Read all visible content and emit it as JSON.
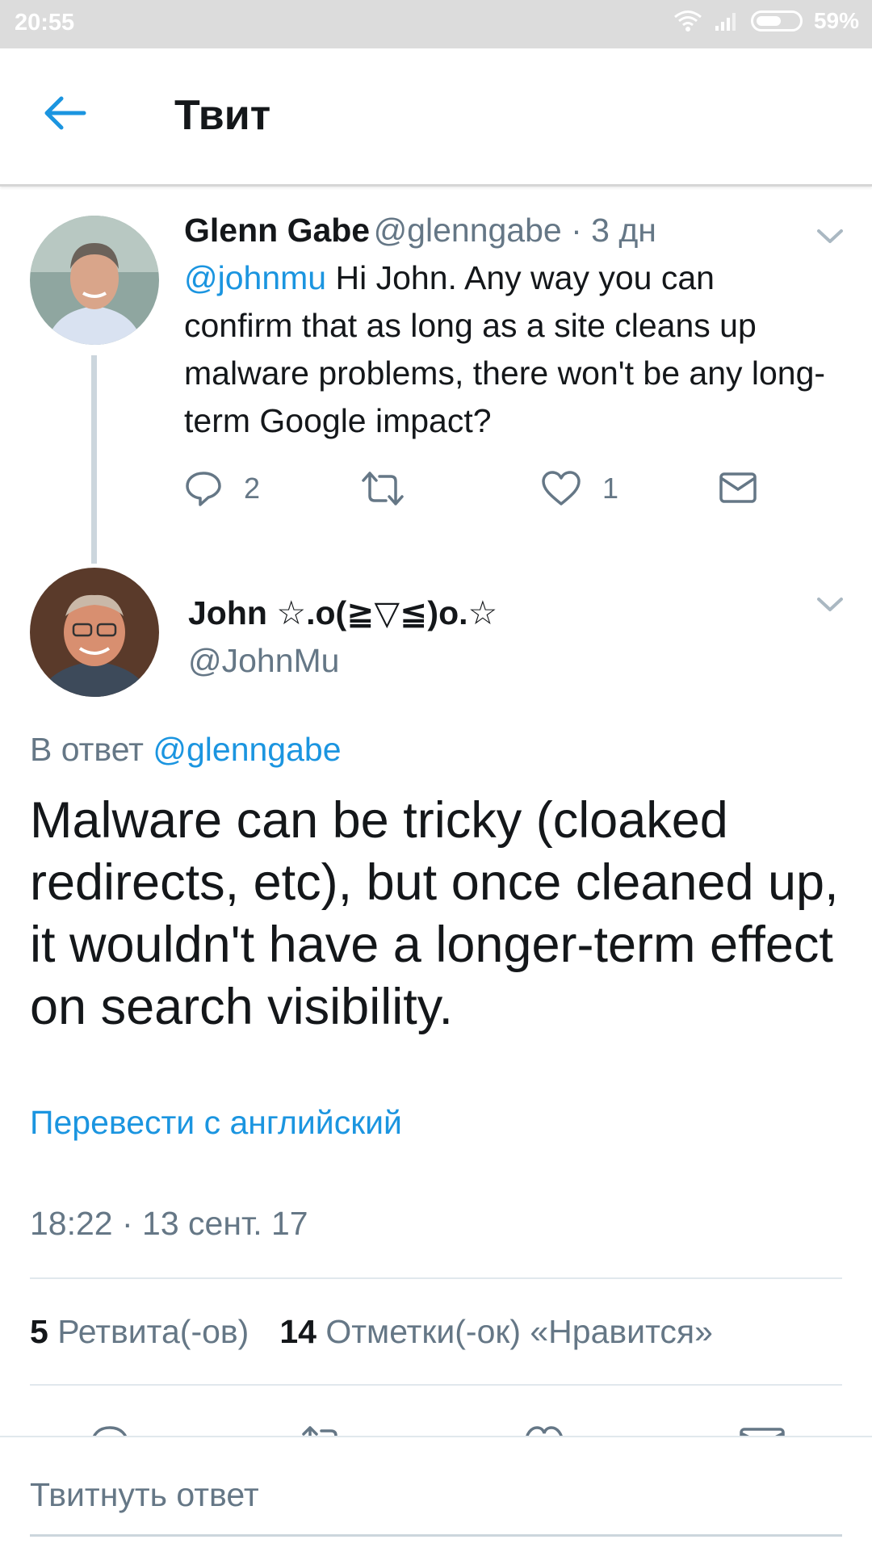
{
  "status_bar": {
    "time": "20:55",
    "battery": "59%",
    "battery_level": 0.59
  },
  "header": {
    "title": "Твит",
    "back_icon": "arrow-left-icon"
  },
  "parent_tweet": {
    "name": "Glenn Gabe",
    "handle": "@glenngabe",
    "age": " · 3 дн",
    "mention": "@johnmu",
    "text": " Hi John. Any way you can confirm that as long as a site cleans up malware problems, there won't be any long-term Google impact?",
    "replies": "2",
    "retweets": "",
    "likes": "1"
  },
  "main_tweet": {
    "name": "John ☆.o(≧▽≦)o.☆",
    "handle": "@JohnMu",
    "reply_prefix": "В ответ ",
    "reply_to": "@glenngabe",
    "text": "Malware can be tricky (cloaked redirects, etc), but once cleaned up, it wouldn't have a longer-term effect on search visibility.",
    "translate": "Перевести с английский",
    "timestamp": "18:22 · 13 сент. 17",
    "retweets_count": "5",
    "retweets_label": "Ретвита(-ов)",
    "likes_count": "14",
    "likes_label": "Отметки(-ок) «Нравится»"
  },
  "composer": {
    "placeholder": "Твитнуть ответ"
  },
  "colors": {
    "accent": "#1b95e0",
    "secondary_text": "#657786",
    "primary_text": "#14171a"
  }
}
